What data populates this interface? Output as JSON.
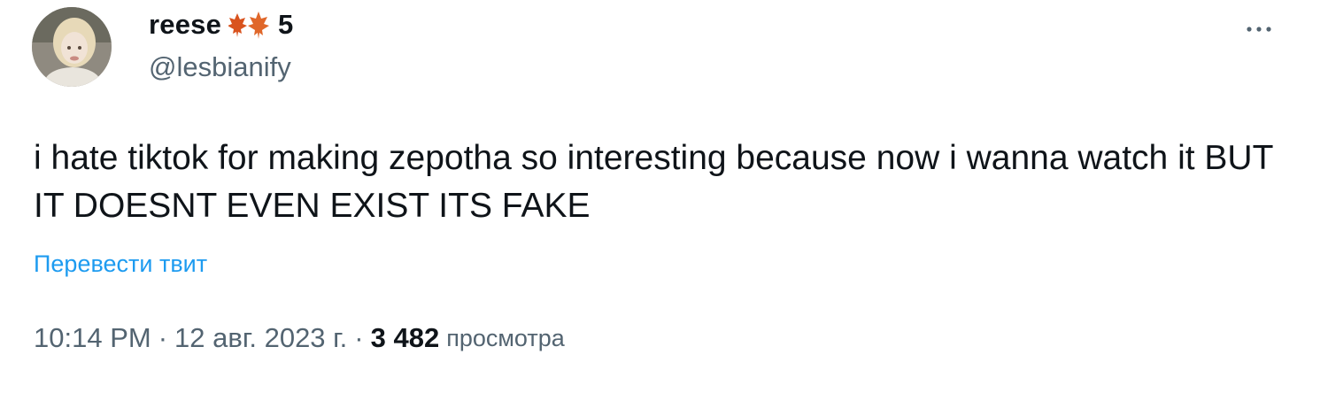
{
  "author": {
    "display_name": "reese",
    "name_emoji": "maple-leaf-emoji",
    "name_suffix": "5",
    "handle": "@lesbianify"
  },
  "tweet": {
    "text": "i hate tiktok for making zepotha so interesting because now i wanna watch it BUT IT DOESNT EVEN EXIST ITS FAKE",
    "translate_label": "Перевести твит"
  },
  "meta": {
    "time": "10:14 PM",
    "separator": "·",
    "date": "12 авг. 2023 г.",
    "views_count": "3 482",
    "views_label": "просмотра"
  },
  "icons": {
    "more": "more-horizontal-icon"
  },
  "colors": {
    "text_primary": "#0f1419",
    "text_secondary": "#536471",
    "link": "#1d9bf0",
    "emoji": "#d9531e"
  }
}
